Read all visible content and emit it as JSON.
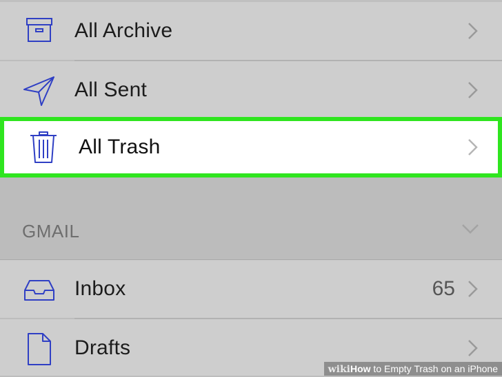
{
  "mailboxes": {
    "all_archive": {
      "label": "All Archive",
      "icon": "archive-box-icon"
    },
    "all_sent": {
      "label": "All Sent",
      "icon": "paper-plane-icon"
    },
    "all_trash": {
      "label": "All Trash",
      "icon": "trash-can-icon",
      "highlighted": true
    }
  },
  "gmail_section": {
    "title": "GMAIL",
    "items": [
      {
        "label": "Inbox",
        "icon": "inbox-tray-icon",
        "count": "65"
      },
      {
        "label": "Drafts",
        "icon": "document-icon"
      }
    ]
  },
  "watermark": {
    "brand": "wiki",
    "title_bold": "How",
    "title_rest": " to Empty Trash on an iPhone"
  },
  "colors": {
    "icon_blue": "#2f3fc4",
    "highlight_border": "#2fe51f",
    "row_bg": "#cecece",
    "section_bg": "#bcbcbc"
  }
}
